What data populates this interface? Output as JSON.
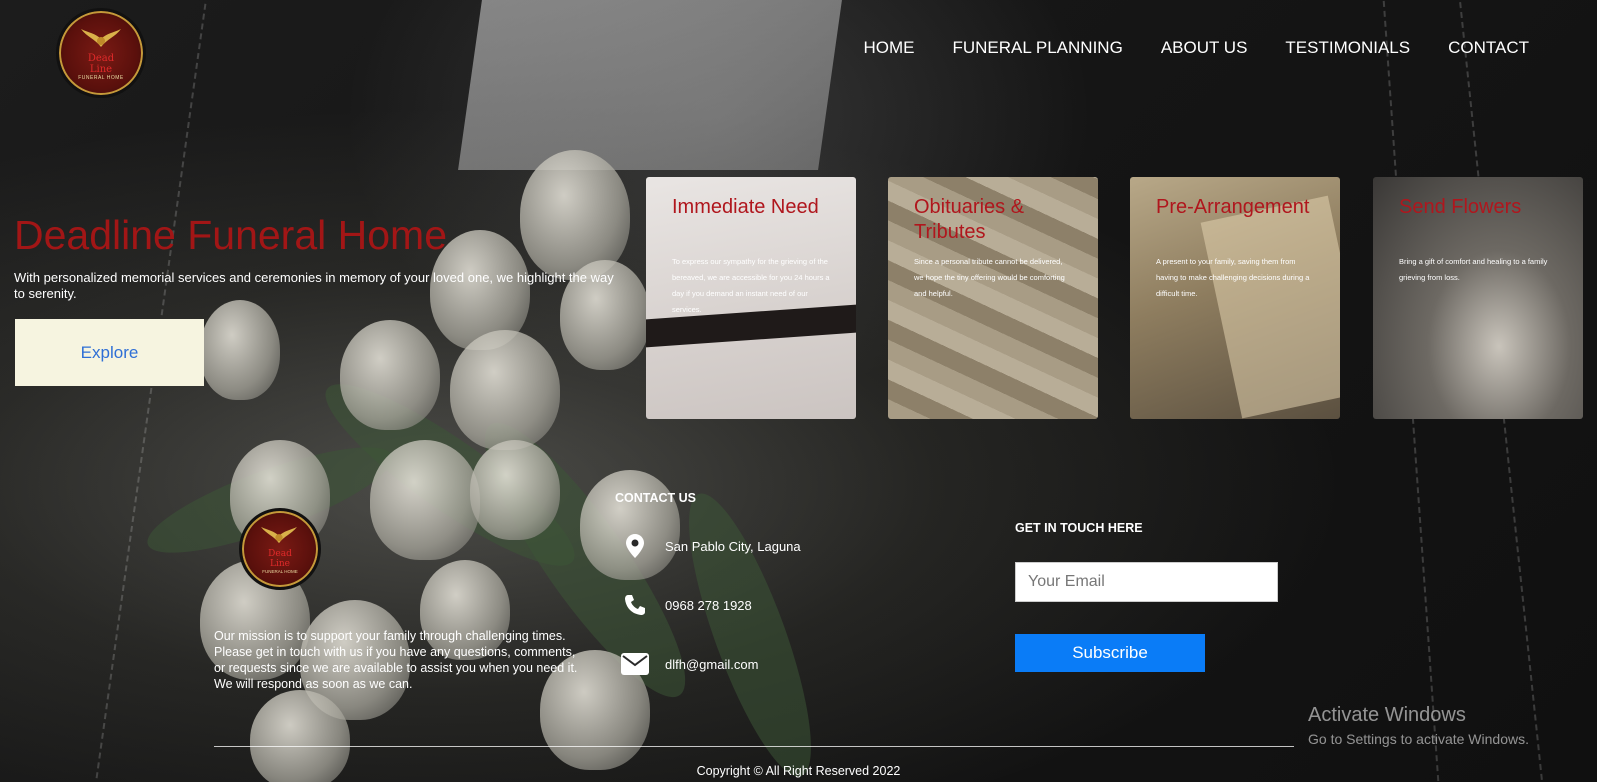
{
  "header": {
    "logo": {
      "text_line1": "Dead",
      "text_line2": "Line",
      "subtitle": "FUNERAL HOME"
    },
    "nav": [
      "HOME",
      "FUNERAL PLANNING",
      "ABOUT US",
      "TESTIMONIALS",
      "CONTACT"
    ]
  },
  "hero": {
    "title": "Deadline Funeral Home",
    "description": "With personalized memorial services and ceremonies in memory of your loved one, we highlight the way to serenity.",
    "button_label": "Explore"
  },
  "cards": [
    {
      "title": "Immediate Need",
      "text": "To express our sympathy for the grieving of the bereaved, we are accessible for you 24 hours a day if you demand an instant need of our services."
    },
    {
      "title": "Obituaries & Tributes",
      "text": "Since a personal tribute cannot be delivered, we hope the tiny offering would be comforting and helpful."
    },
    {
      "title": "Pre-Arrangement",
      "text": "A present to your family, saving them from having to make challenging decisions during a difficult time."
    },
    {
      "title": "Send Flowers",
      "text": "Bring a gift of comfort and healing to a family grieving from loss."
    }
  ],
  "footer": {
    "mission": "Our mission is to support your family through challenging times. Please get in touch with us if you have any questions, comments, or requests since we are available to assist you when you need it. We will respond as soon as we can.",
    "contact_heading": "CONTACT US",
    "contact": {
      "address": "San Pablo City, Laguna",
      "phone": "0968 278 1928",
      "email": "dlfh@gmail.com"
    },
    "newsletter_heading": "GET IN TOUCH HERE",
    "email_placeholder": "Your Email",
    "subscribe_label": "Subscribe",
    "copyright": "Copyright © All Right Reserved 2022"
  },
  "os_overlay": {
    "line1": "Activate Windows",
    "line2": "Go to Settings to activate Windows."
  },
  "colors": {
    "brand_red": "#a21616",
    "subscribe_blue": "#0a7cf7",
    "explore_bg": "#f6f4e0",
    "explore_text": "#2f6fd6"
  },
  "icons": [
    "location-pin-icon",
    "phone-icon",
    "envelope-icon"
  ]
}
